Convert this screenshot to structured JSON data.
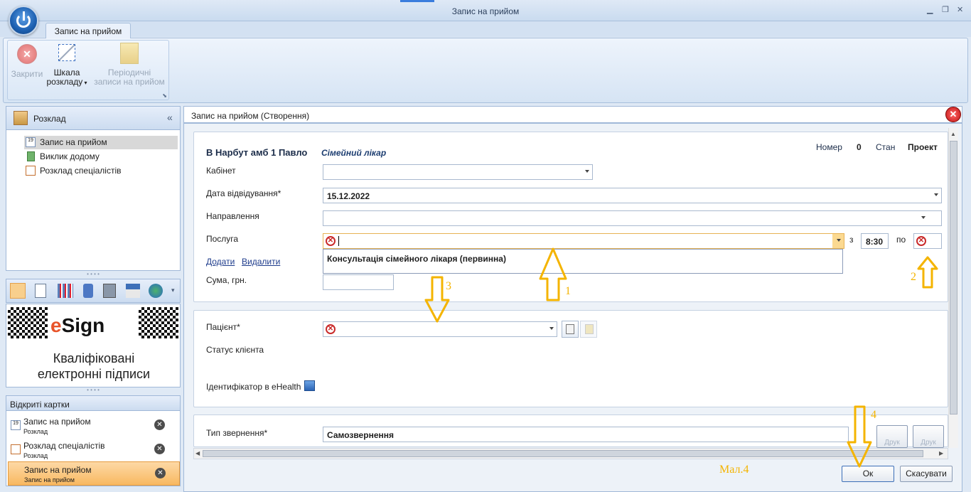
{
  "window": {
    "title": "Запис на прийом"
  },
  "ribbon": {
    "tab": "Запис на прийом",
    "buttons": {
      "close": "Закрити",
      "scale": "Шкала",
      "scale2": "розкладу",
      "periodic": "Періодичні",
      "periodic2": "записи на прийом"
    }
  },
  "nav": {
    "header": "Розклад",
    "items": [
      {
        "label": "Запис на прийом",
        "selected": true
      },
      {
        "label": "Виклик додому"
      },
      {
        "label": "Розклад спеціалістів"
      }
    ]
  },
  "esign": {
    "brand_prefix": "e",
    "brand": "Sign",
    "caption1": "Кваліфіковані",
    "caption2": "електронні підписи"
  },
  "open_cards": {
    "header": "Відкриті картки",
    "items": [
      {
        "title": "Запис на прийом",
        "subtitle": "Розклад"
      },
      {
        "title": "Розклад спеціалістів",
        "subtitle": "Розклад"
      },
      {
        "title": "Запис на прийом",
        "subtitle": "Запис на прийом",
        "selected": true
      }
    ]
  },
  "dialog": {
    "title": "Запис на прийом (Створення)",
    "doctor": "В Нарбут амб 1 Павло",
    "doctor_role": "Сімейний лікар",
    "number_label": "Номер",
    "number_value": "0",
    "state_label": "Стан",
    "state_value": "Проект",
    "fields": {
      "cabinet": {
        "label": "Кабінет",
        "value": ""
      },
      "visit_date": {
        "label": "Дата відвідування*",
        "value": "15.12.2022"
      },
      "direction": {
        "label": "Направлення",
        "value": ""
      },
      "service": {
        "label": "Послуга",
        "value": "",
        "dropdown_option": "Консультація сімейного лікаря (первинна)"
      },
      "from_label": "з",
      "from_time": "8:30",
      "to_label": "по",
      "to_time": "",
      "add_link": "Додати",
      "remove_link": "Видалити",
      "sum": {
        "label": "Сума, грн.",
        "value": ""
      },
      "patient": {
        "label": "Пацієнт*",
        "value": ""
      },
      "client_status": {
        "label": "Статус клієнта"
      },
      "ehealth": {
        "label": "Ідентифікатор в eHealth"
      },
      "request_type": {
        "label": "Тип звернення*",
        "value": "Самозвернення"
      }
    },
    "print1": "Друк",
    "print2": "Друк",
    "ok": "Ок",
    "cancel": "Скасувати"
  },
  "annotations": {
    "a1": "1",
    "a2": "2",
    "a3": "3",
    "a4": "4",
    "caption": "Мал.4"
  },
  "colors": {
    "accent": "#f4b400",
    "error": "#c92a2a",
    "selection_orange": "#f8b860"
  }
}
